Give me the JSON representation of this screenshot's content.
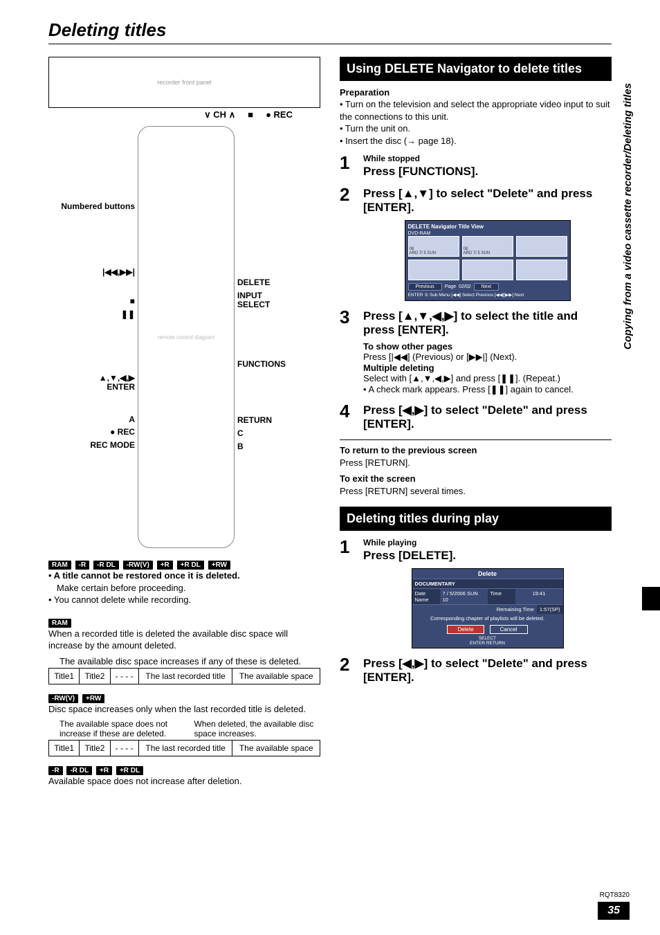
{
  "pageTitle": "Deleting titles",
  "sideLabel": "Copying from a video cassette recorder/Deleting titles",
  "device": {
    "ch": "CH",
    "stop": "■",
    "rec": "● REC"
  },
  "remote": {
    "left": {
      "numbered": "Numbered buttons",
      "skip": "|◀◀,▶▶|",
      "stop": "■",
      "pause": "❚❚",
      "arrows": "▲,▼,◀,▶\nENTER",
      "a": "A",
      "rec": "● REC",
      "recMode": "REC MODE"
    },
    "right": {
      "delete": "DELETE",
      "inputSelect": "INPUT\nSELECT",
      "functions": "FUNCTIONS",
      "return": "RETURN",
      "c": "C",
      "b": "B"
    }
  },
  "badges1": [
    "RAM",
    "-R",
    "-R DL",
    "-RW(V)",
    "+R",
    "+R DL",
    "+RW"
  ],
  "warn1": "• A title cannot be restored once it is deleted.",
  "warn1b": "Make certain before proceeding.",
  "warn2": "• You cannot delete while recording.",
  "badgesRam": [
    "RAM"
  ],
  "ramNote": "When a recorded title is deleted the available disc space will increase by the amount deleted.",
  "spaceCaption1": "The available disc space increases if any of these is deleted.",
  "spaceTable": {
    "c1": "Title1",
    "c2": "Title2",
    "c3": "- - - -",
    "c4": "The last recorded title",
    "c5": "The available space"
  },
  "badgesRW": [
    "-RW(V)",
    "+RW"
  ],
  "rwNote": "Disc space increases only when the last recorded title is deleted.",
  "twoCap": {
    "a": "The available space does not increase if these are deleted.",
    "b": "When deleted, the available disc space increases."
  },
  "badgesR": [
    "-R",
    "-R DL",
    "+R",
    "+R DL"
  ],
  "rNote": "Available space does not increase after deletion.",
  "sect1": "Using DELETE Navigator to delete titles",
  "prep": "Preparation",
  "prep1": "• Turn on the television and select the appropriate video input to suit the connections to this unit.",
  "prep2": "• Turn the unit on.",
  "prep3": "• Insert the disc (→ page 18).",
  "s1a": "While stopped",
  "s1b": "Press [FUNCTIONS].",
  "s2": "Press [▲,▼] to select \"Delete\" and press [ENTER].",
  "nav": {
    "header": "DELETE Navigator   Title View",
    "sub": "DVD-RAM",
    "thumbs": [
      "08\n         ARD  7/ 5 SUN",
      "08\n         ARD  7/ 5 SUN",
      "",
      "",
      "",
      ""
    ],
    "footer": {
      "prev": "Previous",
      "page": "Page",
      "num": "02/02",
      "next": "Next"
    },
    "hint": "ENTER  ① Sub Menu  [◀◀] Select   Previous [◀◀][▶▶] Next"
  },
  "s3": "Press [▲,▼,◀,▶] to select the title and press [ENTER].",
  "s3sub": {
    "a": "To show other pages",
    "b": "Press [|◀◀] (Previous) or [▶▶|] (Next).",
    "c": "Multiple deleting",
    "d": "Select with [▲,▼,◀,▶] and press [❚❚]. (Repeat.)",
    "e": "• A check mark appears. Press [❚❚] again to cancel."
  },
  "s4": "Press [◀,▶] to select \"Delete\" and press [ENTER].",
  "ret1a": "To return to the previous screen",
  "ret1b": "Press [RETURN].",
  "ret2a": "To exit the screen",
  "ret2b": "Press [RETURN] several times.",
  "sect2": "Deleting titles during play",
  "p1a": "While playing",
  "p1b": "Press [DELETE].",
  "deleteDialog": {
    "title": "Delete",
    "docu": "DOCUMENTARY",
    "dateLab": "Date\nName",
    "dateVal": "7 / 5/2006 SUN\n10",
    "timeLab": "Time",
    "timeVal": "19:41",
    "remain": "Remaining Time",
    "remainVal": "1:57(SP)",
    "chap": "Corresponding chapter of playlists will be deleted.",
    "btnDelete": "Delete",
    "btnCancel": "Cancel",
    "hint": "SELECT\nENTER      RETURN"
  },
  "p2": "Press [◀,▶] to select \"Delete\" and press [ENTER].",
  "docCode": "RQT8320",
  "pageNum": "35"
}
